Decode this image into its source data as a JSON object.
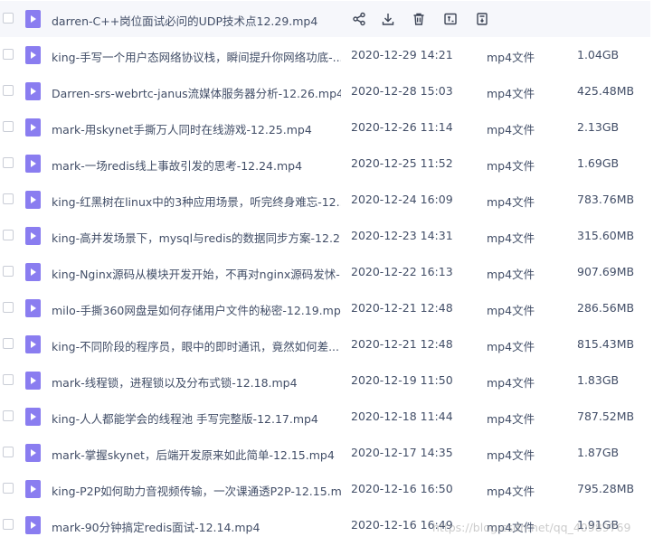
{
  "files": [
    {
      "name": "darren-C++岗位面试必问的UDP技术点12.29.mp4",
      "date": "",
      "type": "",
      "size": ""
    },
    {
      "name": "king-手写一个用户态网络协议栈，瞬间提升你网络功底-...",
      "date": "2020-12-29 14:21",
      "type": "mp4文件",
      "size": "1.04GB"
    },
    {
      "name": "Darren-srs-webrtc-janus流媒体服务器分析-12.26.mp4",
      "date": "2020-12-28 15:03",
      "type": "mp4文件",
      "size": "425.48MB"
    },
    {
      "name": "mark-用skynet手撕万人同时在线游戏-12.25.mp4",
      "date": "2020-12-26 11:14",
      "type": "mp4文件",
      "size": "2.13GB"
    },
    {
      "name": "mark-一场redis线上事故引发的思考-12.24.mp4",
      "date": "2020-12-25 11:52",
      "type": "mp4文件",
      "size": "1.69GB"
    },
    {
      "name": "king-红黑树在linux中的3种应用场景，听完终身难忘-12....",
      "date": "2020-12-24 16:09",
      "type": "mp4文件",
      "size": "783.76MB"
    },
    {
      "name": "king-高并发场景下，mysql与redis的数据同步方案-12.2...",
      "date": "2020-12-23 14:31",
      "type": "mp4文件",
      "size": "315.60MB"
    },
    {
      "name": "king-Nginx源码从模块开发开始，不再对nginx源码发怵-...",
      "date": "2020-12-22 16:13",
      "type": "mp4文件",
      "size": "907.69MB"
    },
    {
      "name": "milo-手撕360网盘是如何存储用户文件的秘密-12.19.mp4",
      "date": "2020-12-21 12:48",
      "type": "mp4文件",
      "size": "286.56MB"
    },
    {
      "name": "king-不同阶段的程序员，眼中的即时通讯，竟然如何差...",
      "date": "2020-12-21 12:48",
      "type": "mp4文件",
      "size": "815.43MB"
    },
    {
      "name": "mark-线程锁，进程锁以及分布式锁-12.18.mp4",
      "date": "2020-12-19 11:50",
      "type": "mp4文件",
      "size": "1.83GB"
    },
    {
      "name": "king-人人都能学会的线程池 手写完整版-12.17.mp4",
      "date": "2020-12-18 11:44",
      "type": "mp4文件",
      "size": "787.52MB"
    },
    {
      "name": "mark-掌握skynet，后端开发原来如此简单-12.15.mp4",
      "date": "2020-12-17 14:35",
      "type": "mp4文件",
      "size": "1.87GB"
    },
    {
      "name": "king-P2P如何助力音视频传输，一次课通透P2P-12.15.m...",
      "date": "2020-12-16 16:50",
      "type": "mp4文件",
      "size": "795.28MB"
    },
    {
      "name": "mark-90分钟搞定redis面试-12.14.mp4",
      "date": "2020-12-16 16:49",
      "type": "mp4文件",
      "size": "1.91GB"
    }
  ],
  "row_actions": [
    "share-icon",
    "download-icon",
    "delete-icon",
    "rename-icon",
    "more-icon"
  ],
  "watermark": "https://blog.csdn.net/qq_40989769",
  "colors": {
    "file_icon": "#8a7df0",
    "hover_row": "#f6f7fb",
    "text": "#424e67"
  }
}
